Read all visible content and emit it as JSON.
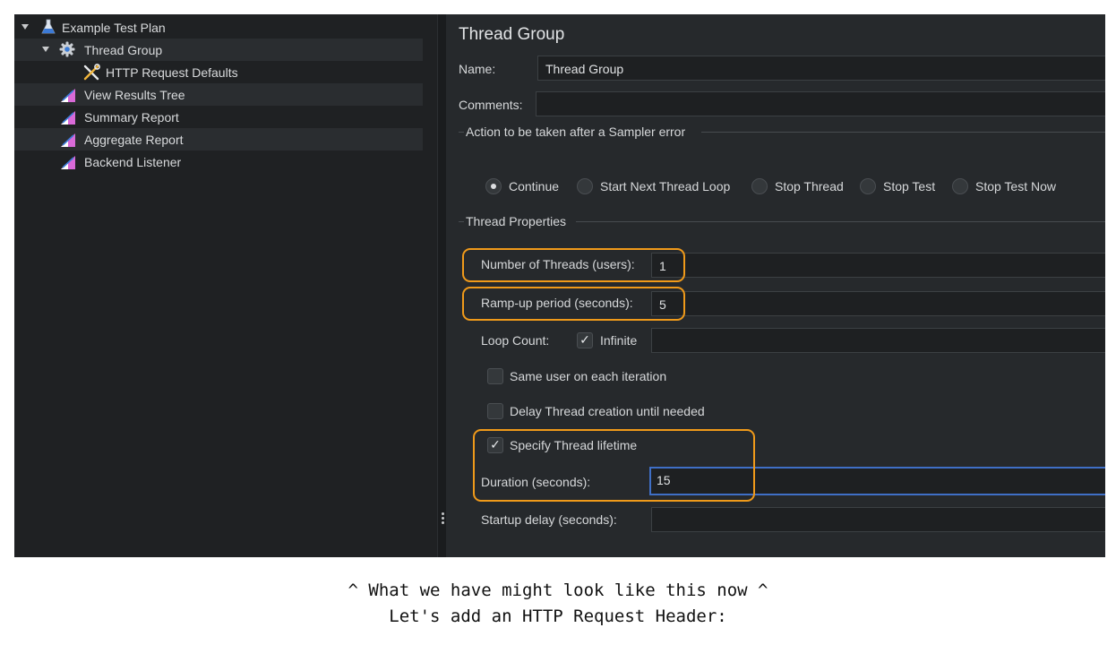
{
  "tree": {
    "items": [
      {
        "label": "Example Test Plan",
        "icon": "flask-icon"
      },
      {
        "label": "Thread Group",
        "icon": "gear-icon"
      },
      {
        "label": "HTTP Request Defaults",
        "icon": "tools-icon"
      },
      {
        "label": "View Results Tree",
        "icon": "chart-icon"
      },
      {
        "label": "Summary Report",
        "icon": "chart-icon"
      },
      {
        "label": "Aggregate Report",
        "icon": "chart-icon"
      },
      {
        "label": "Backend Listener",
        "icon": "chart-icon"
      }
    ]
  },
  "editor": {
    "title": "Thread Group",
    "name_label": "Name:",
    "name_value": "Thread Group",
    "comments_label": "Comments:",
    "comments_value": "",
    "sampler_error": {
      "legend": "Action to be taken after a Sampler error",
      "options": [
        "Continue",
        "Start Next Thread Loop",
        "Stop Thread",
        "Stop Test",
        "Stop Test Now"
      ],
      "selected": "Continue"
    },
    "thread_props": {
      "legend": "Thread Properties",
      "threads_label": "Number of Threads (users):",
      "threads_value": "1",
      "rampup_label": "Ramp-up period (seconds):",
      "rampup_value": "5",
      "loop_label": "Loop Count:",
      "infinite_label": "Infinite",
      "infinite_checked": true,
      "same_user_label": "Same user on each iteration",
      "same_user_checked": false,
      "delay_label": "Delay Thread creation until needed",
      "delay_checked": false,
      "lifetime_label": "Specify Thread lifetime",
      "lifetime_checked": true,
      "duration_label": "Duration (seconds):",
      "duration_value": "15",
      "startup_label": "Startup delay (seconds):",
      "startup_value": ""
    }
  },
  "caption": {
    "line1": "^ What we have might look like this now ^",
    "line2": "Let's add an HTTP Request Header:"
  },
  "colors": {
    "highlight": "#f09a1a",
    "focus": "#3f6fc6",
    "panel": "#26292c",
    "tree_bg": "#1f2123"
  }
}
